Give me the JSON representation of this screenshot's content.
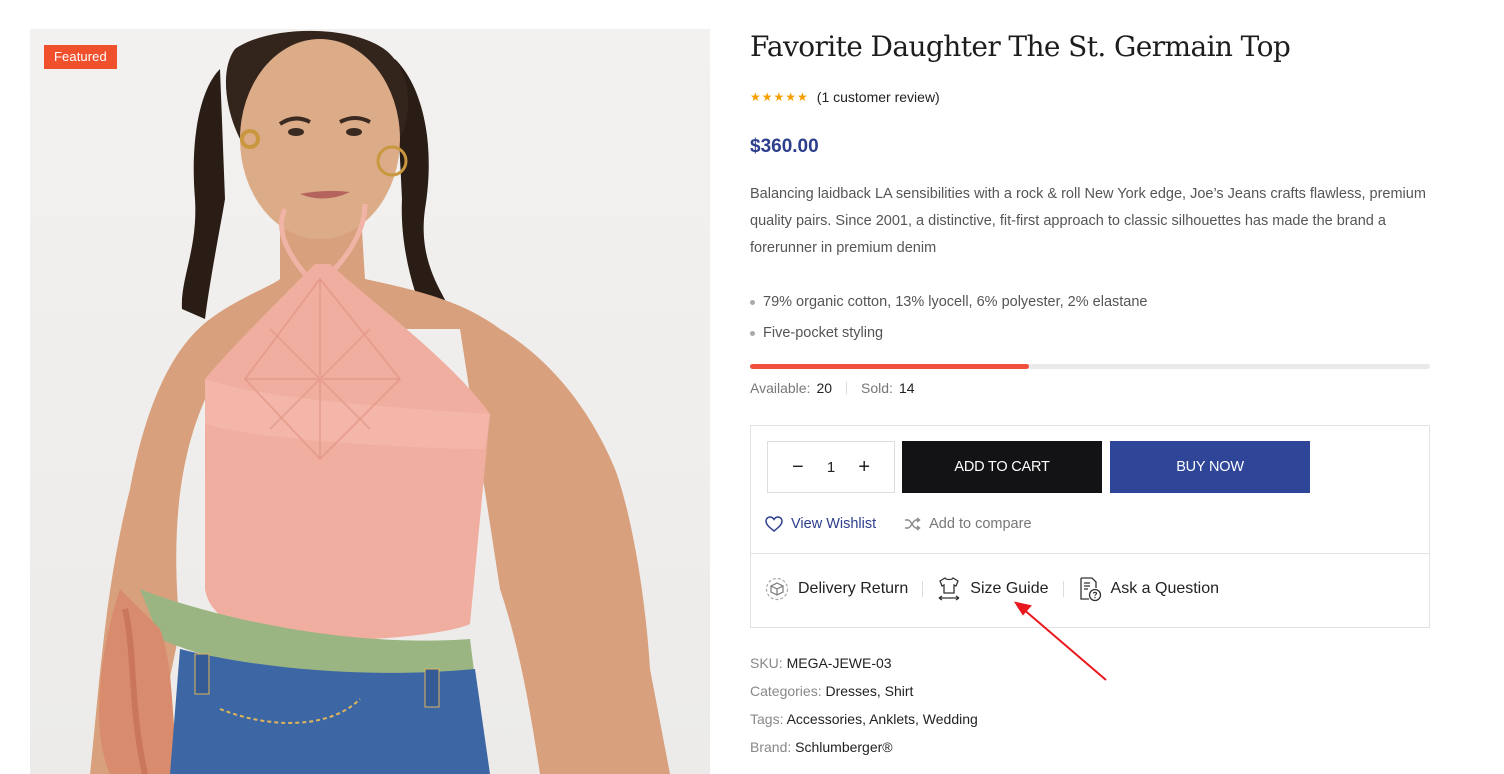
{
  "badge": "Featured",
  "product": {
    "title": "Favorite Daughter The St. Germain Top",
    "stars": "★★★★★",
    "review_text": "(1 customer review)",
    "price": "$360.00",
    "description": "Balancing laidback LA sensibilities with a rock & roll New York edge, Joe’s Jeans crafts flawless, premium quality pairs. Since 2001, a distinctive, fit-first approach to classic silhouettes has made the brand a forerunner in premium denim",
    "bullets": [
      "79% organic cotton, 13% lyocell, 6% polyester, 2% elastane",
      "Five-pocket styling"
    ]
  },
  "stock": {
    "available_label": "Available:",
    "available": "20",
    "sold_label": "Sold:",
    "sold": "14",
    "sold_fraction": 0.41
  },
  "purchase": {
    "minus": "−",
    "quantity": "1",
    "plus": "+",
    "add_to_cart": "ADD TO CART",
    "buy_now": "BUY NOW",
    "wishlist": "View Wishlist",
    "compare": "Add to compare",
    "delivery_return": "Delivery Return",
    "size_guide": "Size Guide",
    "ask_question": "Ask a Question"
  },
  "meta": {
    "sku_label": "SKU:",
    "sku": "MEGA-JEWE-03",
    "categories_label": "Categories:",
    "categories": [
      "Dresses",
      "Shirt"
    ],
    "tags_label": "Tags:",
    "tags": [
      "Accessories",
      "Anklets",
      "Wedding"
    ],
    "brand_label": "Brand:",
    "brand": "Schlumberger®"
  },
  "colors": {
    "price": "#2d3e8c",
    "buy_now": "#2f4597",
    "add_to_cart": "#131316",
    "badge": "#f0502c",
    "progress": "#f0503c",
    "stars": "#f6a000",
    "annotation_arrow": "#e8181e"
  },
  "icons": [
    "heart-icon",
    "shuffle-icon",
    "delivery-box-icon",
    "tshirt-ruler-icon",
    "question-doc-icon"
  ]
}
